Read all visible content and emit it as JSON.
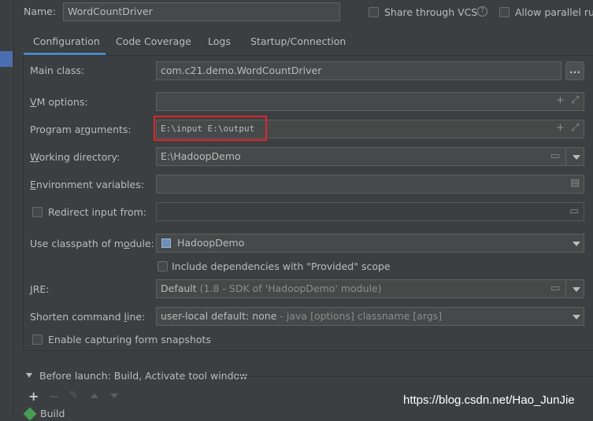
{
  "header": {
    "name_label": "Name:",
    "name_value": "WordCountDriver",
    "share_label": "Share through VCS",
    "share_help": "?",
    "parallel_label": "Allow parallel run"
  },
  "tabs": [
    "Configuration",
    "Code Coverage",
    "Logs",
    "Startup/Connection"
  ],
  "form": {
    "main_class_label": "Main class:",
    "main_class_value": "com.c21.demo.WordCountDriver",
    "browse_label": "...",
    "vm_options_label": "VM options:",
    "vm_options_value": "",
    "program_args_label": "Program arguments:",
    "program_args_value": "E:\\input E:\\output",
    "working_dir_label": "Working directory:",
    "working_dir_value": "E:\\HadoopDemo",
    "env_vars_label": "Environment variables:",
    "env_vars_value": "",
    "redirect_label": "Redirect input from:",
    "redirect_value": "",
    "classpath_label": "Use classpath of module:",
    "classpath_value": "HadoopDemo",
    "include_deps_label": "Include dependencies with \"Provided\" scope",
    "jre_label": "JRE:",
    "jre_value": "Default",
    "jre_detail": "(1.8 - SDK of 'HadoopDemo' module)",
    "shorten_label": "Shorten command line:",
    "shorten_value": "user-local default: none",
    "shorten_detail": "- java [options] classname [args]",
    "snapshots_label": "Enable capturing form snapshots"
  },
  "before_launch": {
    "title": "Before launch: Build, Activate tool window",
    "item": "Build"
  },
  "watermark": "https://blog.csdn.net/Hao_JunJie",
  "colors": {
    "background": "#3c3f41",
    "field": "#45494a",
    "accent": "#4a88c7",
    "highlight_box": "#e0242a"
  }
}
